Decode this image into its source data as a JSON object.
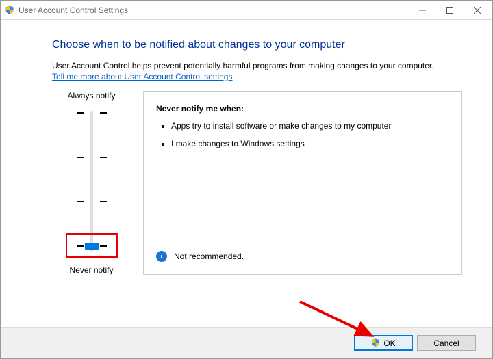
{
  "window": {
    "title": "User Account Control Settings"
  },
  "heading": "Choose when to be notified about changes to your computer",
  "description": "User Account Control helps prevent potentially harmful programs from making changes to your computer.",
  "link_text": "Tell me more about User Account Control settings",
  "slider": {
    "top_label": "Always notify",
    "bottom_label": "Never notify",
    "position": 3,
    "ticks": 4
  },
  "info": {
    "title": "Never notify me when:",
    "bullets": [
      "Apps try to install software or make changes to my computer",
      "I make changes to Windows settings"
    ],
    "footer_text": "Not recommended."
  },
  "buttons": {
    "ok": "OK",
    "cancel": "Cancel"
  }
}
